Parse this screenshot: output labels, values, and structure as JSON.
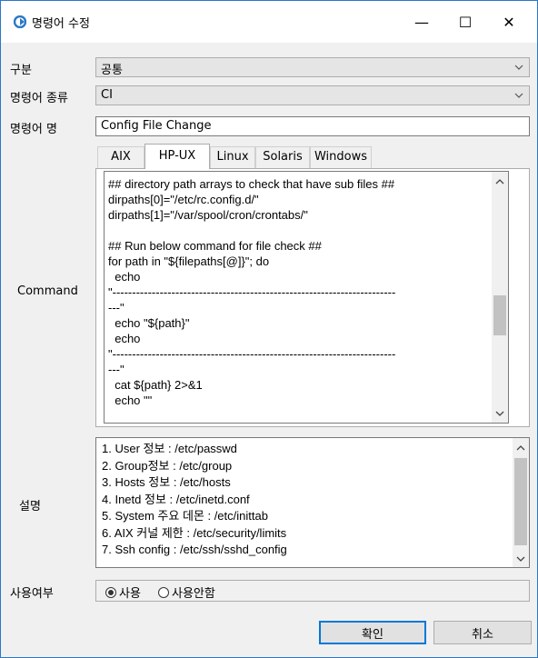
{
  "window": {
    "title": "명령어 수정",
    "minimize_glyph": "—",
    "maximize_glyph": "☐",
    "close_glyph": "✕",
    "accent_color": "#2a78c8"
  },
  "form": {
    "category": {
      "label": "구분",
      "value": "공통"
    },
    "command_type": {
      "label": "명령어 종류",
      "value": "CI"
    },
    "command_name": {
      "label": "명령어 명",
      "value": "Config File Change"
    },
    "command": {
      "label": "Command",
      "tabs": [
        "AIX",
        "HP-UX",
        "Linux",
        "Solaris",
        "Windows"
      ],
      "active_tab": "HP-UX",
      "text": "## directory path arrays to check that have sub files ##\ndirpaths[0]=\"/etc/rc.config.d/\"\ndirpaths[1]=\"/var/spool/cron/crontabs/\"\n\n## Run below command for file check ##\nfor path in \"${filepaths[@]}\"; do\n  echo\n\"------------------------------------------------------------------------\n---\"\n  echo \"${path}\"\n  echo\n\"------------------------------------------------------------------------\n---\"\n  cat ${path} 2>&1\n  echo \"\"\n"
    },
    "description": {
      "label": "설명",
      "text": "1. User 정보 : /etc/passwd\n2. Group정보 : /etc/group\n3. Hosts 정보 : /etc/hosts\n4. Inetd 정보 : /etc/inetd.conf\n5. System 주요 데몬 : /etc/inittab\n6. AIX 커널 제한 : /etc/security/limits\n7. Ssh config : /etc/ssh/sshd_config"
    },
    "usage": {
      "label": "사용여부",
      "options": [
        "사용",
        "사용안함"
      ],
      "selected": "사용"
    }
  },
  "buttons": {
    "ok": "확인",
    "cancel": "취소"
  }
}
